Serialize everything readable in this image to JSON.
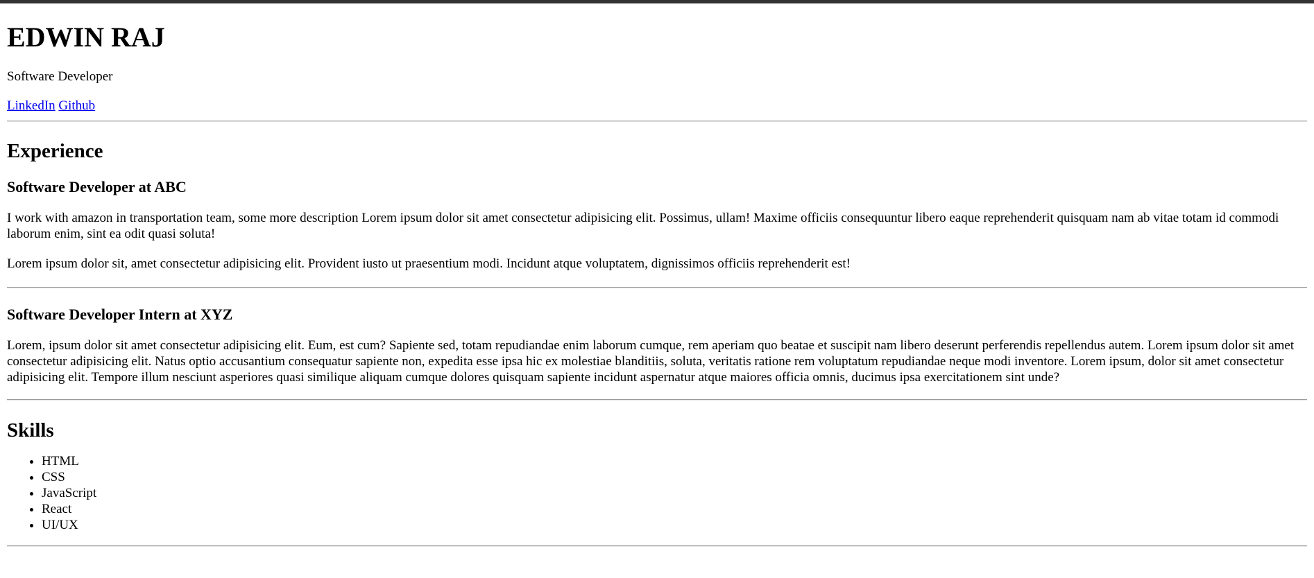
{
  "header": {
    "name": "EDWIN RAJ",
    "role": "Software Developer",
    "links": [
      {
        "label": "LinkedIn"
      },
      {
        "label": "Github"
      }
    ]
  },
  "experience": {
    "heading": "Experience",
    "jobs": [
      {
        "title": "Software Developer at ABC",
        "paragraphs": [
          "I work with amazon in transportation team, some more description Lorem ipsum dolor sit amet consectetur adipisicing elit. Possimus, ullam! Maxime officiis consequuntur libero eaque reprehenderit quisquam nam ab vitae totam id commodi laborum enim, sint ea odit quasi soluta!",
          "Lorem ipsum dolor sit, amet consectetur adipisicing elit. Provident iusto ut praesentium modi. Incidunt atque voluptatem, dignissimos officiis reprehenderit est!"
        ]
      },
      {
        "title": "Software Developer Intern at XYZ",
        "paragraphs": [
          "Lorem, ipsum dolor sit amet consectetur adipisicing elit. Eum, est cum? Sapiente sed, totam repudiandae enim laborum cumque, rem aperiam quo beatae et suscipit nam libero deserunt perferendis repellendus autem. Lorem ipsum dolor sit amet consectetur adipisicing elit. Natus optio accusantium consequatur sapiente non, expedita esse ipsa hic ex molestiae blanditiis, soluta, veritatis ratione rem voluptatum repudiandae neque modi inventore. Lorem ipsum, dolor sit amet consectetur adipisicing elit. Tempore illum nesciunt asperiores quasi similique aliquam cumque dolores quisquam sapiente incidunt aspernatur atque maiores officia omnis, ducimus ipsa exercitationem sint unde?"
        ]
      }
    ]
  },
  "skills": {
    "heading": "Skills",
    "items": [
      "HTML",
      "CSS",
      "JavaScript",
      "React",
      "UI/UX"
    ]
  },
  "colors": {
    "link": "#0000ee",
    "topbar": "#333333",
    "divider": "#9a9a9a"
  }
}
